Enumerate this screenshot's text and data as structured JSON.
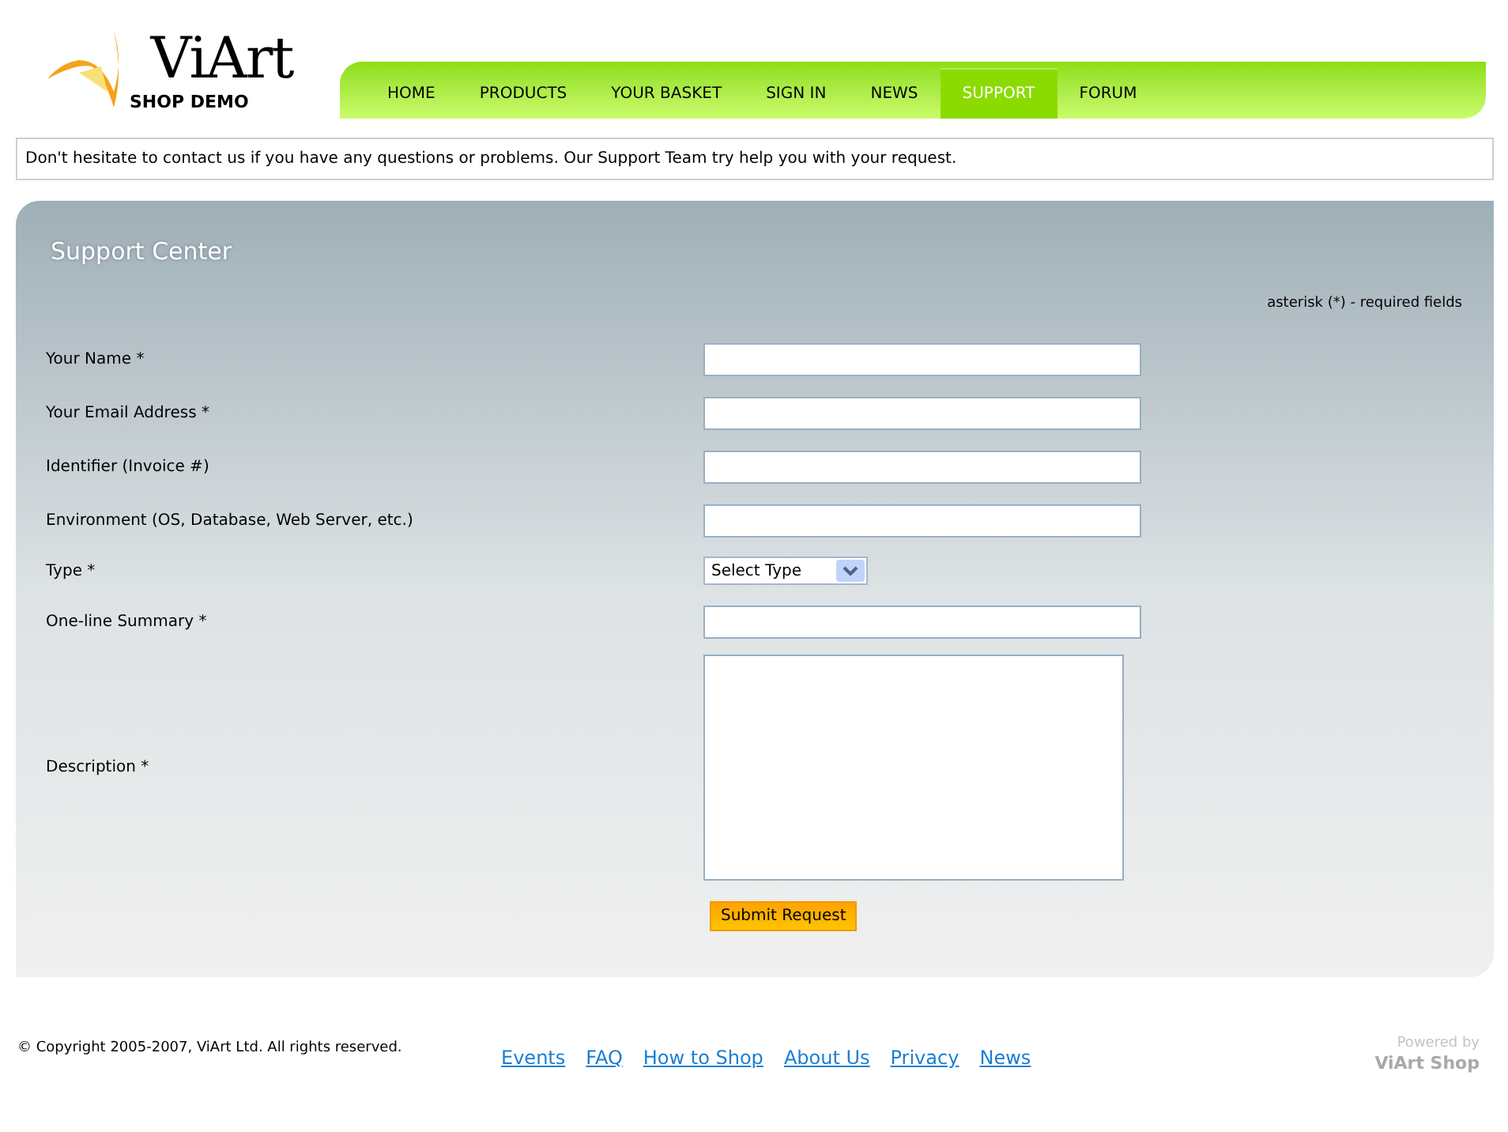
{
  "logo": {
    "name": "ViArt",
    "subtitle": "SHOP DEMO"
  },
  "nav": [
    {
      "label": "HOME",
      "selected": false
    },
    {
      "label": "PRODUCTS",
      "selected": false
    },
    {
      "label": "YOUR BASKET",
      "selected": false
    },
    {
      "label": "SIGN IN",
      "selected": false
    },
    {
      "label": "NEWS",
      "selected": false
    },
    {
      "label": "SUPPORT",
      "selected": true
    },
    {
      "label": "FORUM",
      "selected": false
    }
  ],
  "notice": "Don't hesitate to contact us if you have any questions or problems. Our Support Team try help you with your request.",
  "panel": {
    "title": "Support  Center",
    "required_note": "asterisk (*) - required fields",
    "fields": [
      {
        "label": "Your Name *",
        "kind": "text"
      },
      {
        "label": "Your Email Address *",
        "kind": "text"
      },
      {
        "label": "Identifier (Invoice #)",
        "kind": "text"
      },
      {
        "label": "Environment (OS, Database, Web Server, etc.)",
        "kind": "text"
      },
      {
        "label": "Type *",
        "kind": "select",
        "value": "Select Type"
      },
      {
        "label": "One-line Summary *",
        "kind": "text"
      },
      {
        "label": "Description *",
        "kind": "textarea"
      }
    ],
    "submit": "Submit Request"
  },
  "footer": {
    "copyright": "© Copyright 2005-2007, ViArt Ltd. All rights reserved.",
    "links": [
      "Events",
      "FAQ",
      "How to Shop",
      "About Us",
      "Privacy",
      "News"
    ],
    "powered_by": "Powered by",
    "powered_name": "ViArt Shop"
  }
}
